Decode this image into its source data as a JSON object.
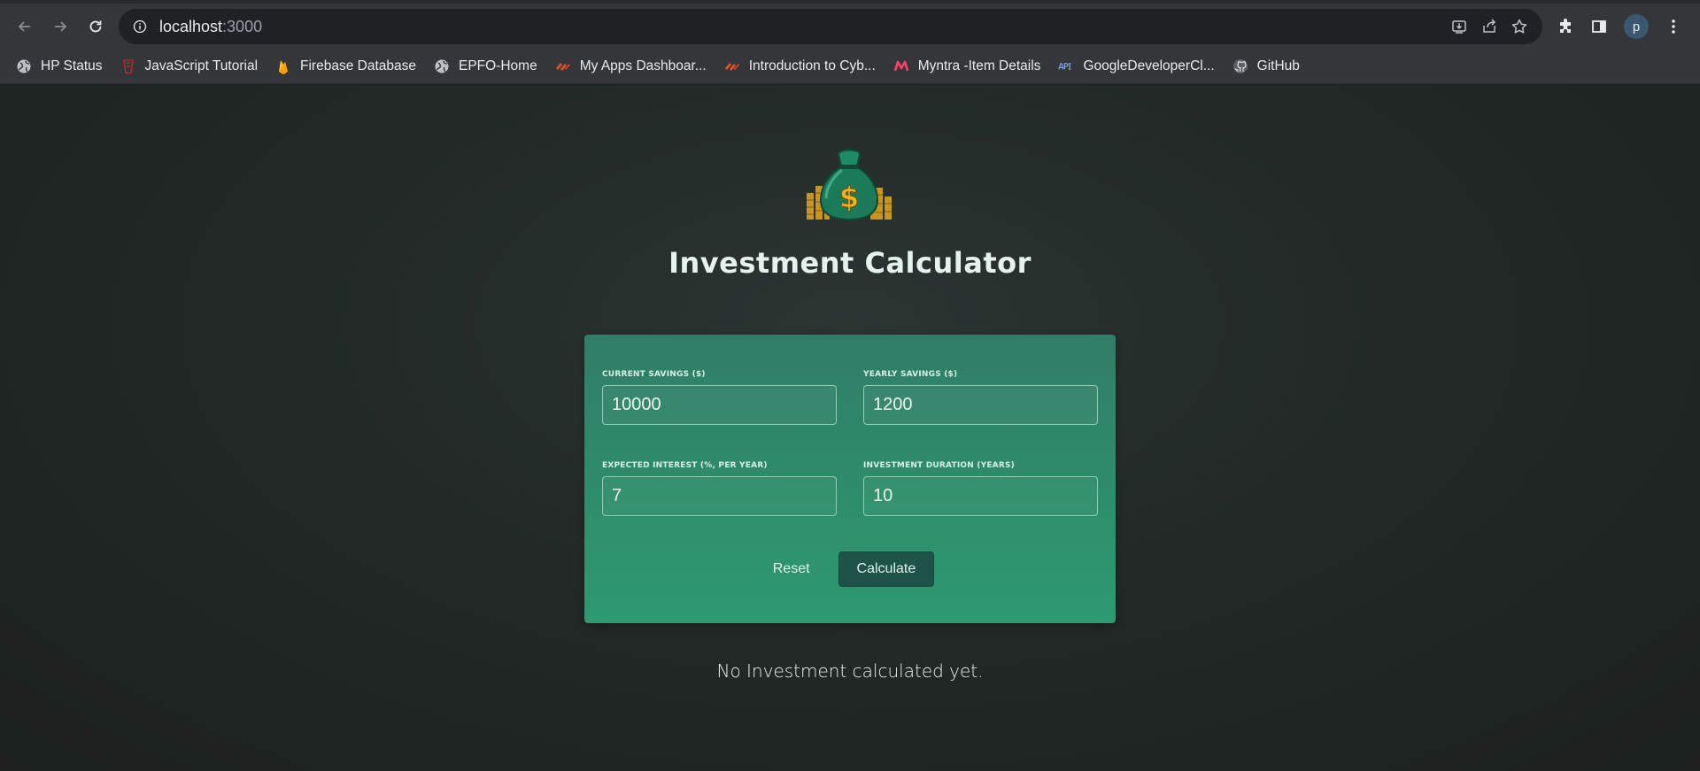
{
  "browser": {
    "url_host": "localhost",
    "url_port": ":3000",
    "avatar_letter": "p",
    "bookmarks": [
      {
        "label": "HP Status",
        "icon": "globe-icon"
      },
      {
        "label": "JavaScript Tutorial",
        "icon": "js-tutorial-icon"
      },
      {
        "label": "Firebase Database",
        "icon": "firebase-icon"
      },
      {
        "label": "EPFO-Home",
        "icon": "globe-icon"
      },
      {
        "label": "My Apps Dashboar...",
        "icon": "apps-dashboard-icon"
      },
      {
        "label": "Introduction to Cyb...",
        "icon": "apps-dashboard-icon"
      },
      {
        "label": "Myntra -Item Details",
        "icon": "myntra-icon"
      },
      {
        "label": "GoogleDeveloperCl...",
        "icon": "api-icon"
      },
      {
        "label": "GitHub",
        "icon": "github-icon"
      }
    ]
  },
  "app": {
    "title": "Investment Calculator",
    "fields": {
      "current_savings": {
        "label": "CURRENT SAVINGS ($)",
        "value": "10000"
      },
      "yearly_savings": {
        "label": "YEARLY SAVINGS ($)",
        "value": "1200"
      },
      "expected_interest": {
        "label": "EXPECTED INTEREST (%, PER YEAR)",
        "value": "7"
      },
      "investment_duration": {
        "label": "INVESTMENT DURATION (YEARS)",
        "value": "10"
      }
    },
    "reset_label": "Reset",
    "calculate_label": "Calculate",
    "result_text": "No Investment calculated yet."
  },
  "colors": {
    "card_top": "#307d67",
    "card_bottom": "#2d9a70",
    "calc_button": "#1d5447",
    "page_bg": "#202624"
  }
}
